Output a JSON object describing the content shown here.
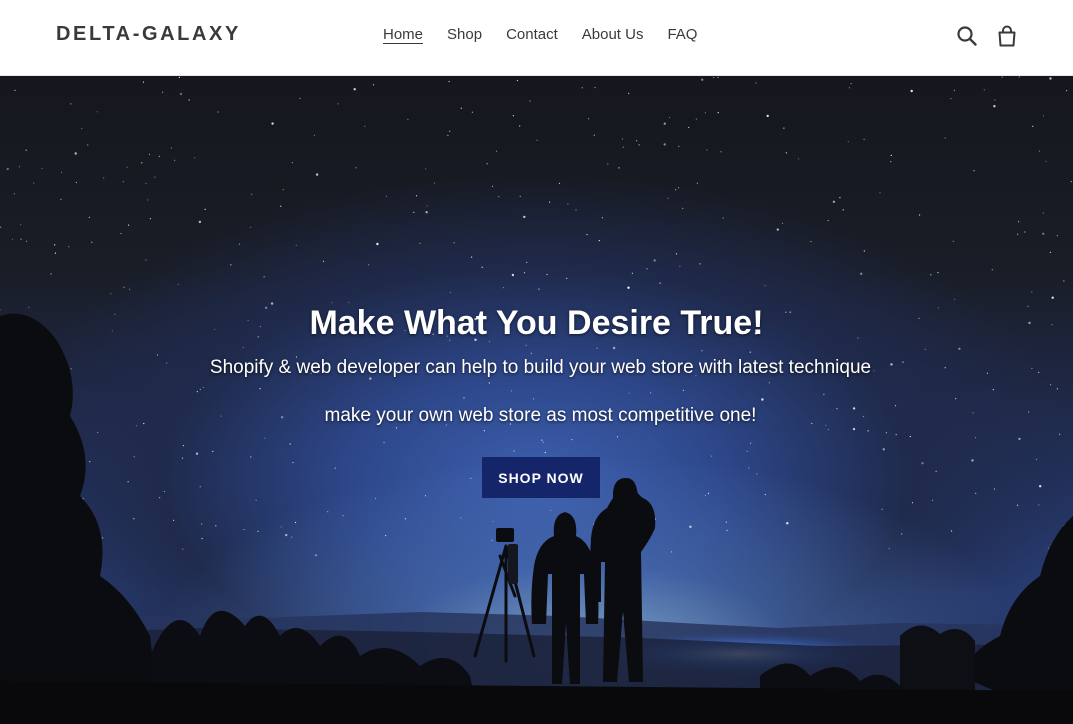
{
  "header": {
    "logo": "DELTA-GALAXY",
    "nav": [
      {
        "label": "Home",
        "active": true
      },
      {
        "label": "Shop",
        "active": false
      },
      {
        "label": "Contact",
        "active": false
      },
      {
        "label": "About Us",
        "active": false
      },
      {
        "label": "FAQ",
        "active": false
      }
    ],
    "icons": [
      "search-icon",
      "cart-icon"
    ]
  },
  "hero": {
    "title": "Make What You Desire True!",
    "subtitle_line1": "Shopify & web developer can help to build your web store with latest technique",
    "subtitle_line2": "make your own web store as most competitive one!",
    "button_label": "SHOP NOW",
    "button_color": "#15256a"
  },
  "colors": {
    "header_bg": "#ffffff",
    "text": "#3a3a3a"
  }
}
